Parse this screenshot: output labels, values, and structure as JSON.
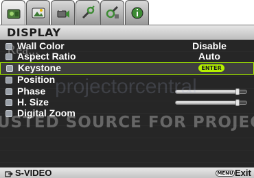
{
  "tabs": [
    {
      "icon": "display-menu-icon",
      "active": true
    },
    {
      "icon": "picture-menu-icon",
      "active": false
    },
    {
      "icon": "source-menu-icon",
      "active": false
    },
    {
      "icon": "setup-menu-icon",
      "active": false
    },
    {
      "icon": "advanced-setup-menu-icon",
      "active": false
    },
    {
      "icon": "information-menu-icon",
      "active": false
    }
  ],
  "menu_title": "DISPLAY",
  "items": [
    {
      "label": "Wall Color",
      "value": "Disable",
      "icon": "wall-color-icon"
    },
    {
      "label": "Aspect Ratio",
      "value": "Auto",
      "icon": "aspect-ratio-icon"
    },
    {
      "label": "Keystone",
      "value": "ENTER",
      "icon": "keystone-icon",
      "selected": true
    },
    {
      "label": "Position",
      "icon": "position-icon"
    },
    {
      "label": "Phase",
      "icon": "phase-icon",
      "level": 0.92
    },
    {
      "label": "H. Size",
      "icon": "h-size-icon",
      "level": 0.92
    },
    {
      "label": "Digital Zoom",
      "icon": "digital-zoom-icon"
    }
  ],
  "watermark": {
    "top": "Rea...",
    "middle": "projectorcentral",
    "line": "USTED SOURCE FOR PROJEC"
  },
  "footer": {
    "source_label": "S-VIDEO",
    "menu_key": "MENU",
    "exit_label": "Exit"
  },
  "colors": {
    "accent": "#b5f000",
    "panel": "#262626",
    "title_bar": "#d0d0d0"
  }
}
